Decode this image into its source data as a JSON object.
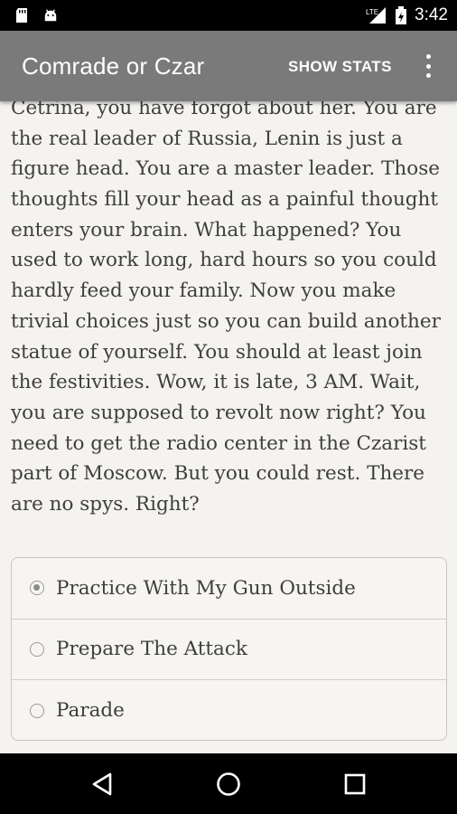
{
  "status_bar": {
    "left_icons": [
      "sd-card-icon",
      "android-icon"
    ],
    "network": "LTE",
    "time": "3:42"
  },
  "app_bar": {
    "title": "Comrade or Czar",
    "action_label": "SHOW STATS",
    "overflow_icon": "more-vert-icon"
  },
  "story": {
    "lines": [
      "Cetrina, you have forgot about her. You are",
      "the real leader of Russia, Lenin is just a",
      "figure head. You are a master leader. Those",
      "thoughts fill your head as a painful thought",
      "enters your brain. What happened? You",
      "used to work long, hard hours so you could",
      "hardly feed your family. Now you make",
      "trivial choices just so you can build another",
      "statue of yourself. You should at least join",
      "the festivities. Wow, it is late, 3 AM. Wait,",
      "you are supposed to revolt now right? You",
      "need to get the radio center in the Czarist",
      "part of Moscow. But you could rest. There",
      "are no spys. Right?"
    ]
  },
  "choices": [
    {
      "label": "Practice With My Gun Outside",
      "selected": true
    },
    {
      "label": "Prepare The Attack",
      "selected": false
    },
    {
      "label": "Parade",
      "selected": false
    }
  ],
  "nav_bar": {
    "buttons": [
      "back-icon",
      "home-icon",
      "recents-icon"
    ]
  },
  "colors": {
    "app_bar": "#7a7a7a",
    "background": "#f5f3ef",
    "text": "#3e3e3e"
  }
}
